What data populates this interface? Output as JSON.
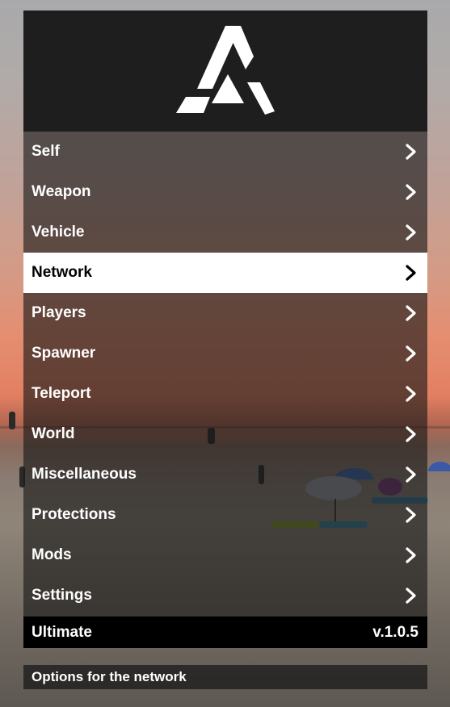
{
  "colors": {
    "banner": "#1e1e1e",
    "item_text": "#ffffff",
    "selected_bg": "#ffffff",
    "selected_text": "#000000",
    "footer_bg": "#000000"
  },
  "banner": {
    "logo_icon": "triangle-logo-icon"
  },
  "menu": {
    "items": [
      {
        "label": "Self",
        "icon": "chevron-right-icon"
      },
      {
        "label": "Weapon",
        "icon": "chevron-right-icon"
      },
      {
        "label": "Vehicle",
        "icon": "chevron-right-icon"
      },
      {
        "label": "Network",
        "icon": "chevron-right-icon",
        "selected": true
      },
      {
        "label": "Players",
        "icon": "chevron-right-icon"
      },
      {
        "label": "Spawner",
        "icon": "chevron-right-icon"
      },
      {
        "label": "Teleport",
        "icon": "chevron-right-icon"
      },
      {
        "label": "World",
        "icon": "chevron-right-icon"
      },
      {
        "label": "Miscellaneous",
        "icon": "chevron-right-icon"
      },
      {
        "label": "Protections",
        "icon": "chevron-right-icon"
      },
      {
        "label": "Mods",
        "icon": "chevron-right-icon"
      },
      {
        "label": "Settings",
        "icon": "chevron-right-icon"
      }
    ]
  },
  "footer": {
    "title": "Ultimate",
    "version": "v.1.0.5"
  },
  "description": {
    "text": "Options for the network"
  }
}
